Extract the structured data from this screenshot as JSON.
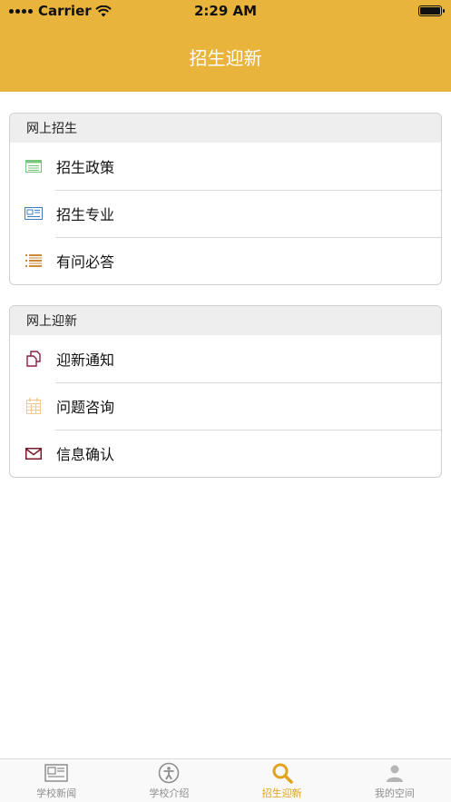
{
  "status_bar": {
    "carrier": "Carrier",
    "time": "2:29 AM"
  },
  "nav": {
    "title": "招生迎新"
  },
  "sections": [
    {
      "header": "网上招生",
      "items": [
        {
          "label": "招生政策",
          "icon": "list-table-icon",
          "color": "#7cc47c"
        },
        {
          "label": "招生专业",
          "icon": "newspaper-icon",
          "color": "#3f7fbf"
        },
        {
          "label": "有问必答",
          "icon": "numbered-list-icon",
          "color": "#c98a3c"
        }
      ]
    },
    {
      "header": "网上迎新",
      "items": [
        {
          "label": "迎新通知",
          "icon": "copy-docs-icon",
          "color": "#8a1f4a"
        },
        {
          "label": "问题咨询",
          "icon": "calendar-icon",
          "color": "#f0c890"
        },
        {
          "label": "信息确认",
          "icon": "envelope-icon",
          "color": "#7a1a2a"
        }
      ]
    }
  ],
  "tabs": [
    {
      "label": "学校新闻",
      "icon": "news-icon",
      "active": false
    },
    {
      "label": "学校介绍",
      "icon": "accessibility-icon",
      "active": false
    },
    {
      "label": "招生迎新",
      "icon": "search-icon",
      "active": true
    },
    {
      "label": "我的空间",
      "icon": "user-icon",
      "active": false
    }
  ],
  "colors": {
    "accent": "#e8b43c",
    "tab_active": "#e0a21f",
    "tab_inactive": "#8e8e8e"
  }
}
